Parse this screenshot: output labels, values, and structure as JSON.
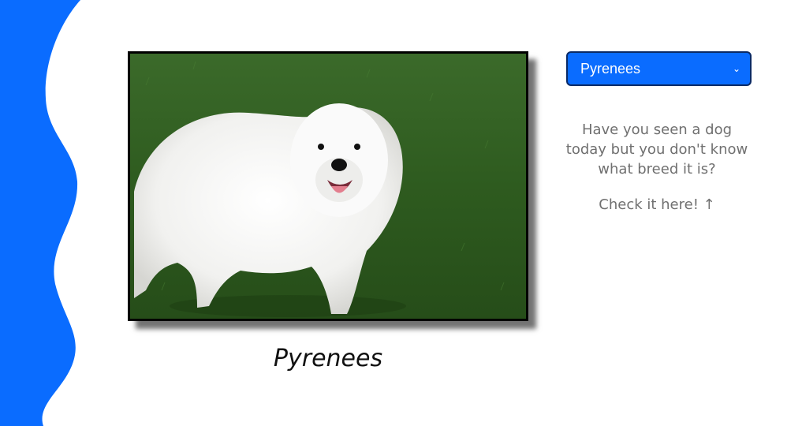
{
  "colors": {
    "accent": "#0a6cff",
    "info_text": "#707070"
  },
  "breed_select": {
    "selected": "Pyrenees",
    "icon": "chevron-down-icon"
  },
  "photo": {
    "icon": "dog-photo"
  },
  "caption": "Pyrenees",
  "info": {
    "question": "Have you seen a dog today but you don't know what breed it is?",
    "cta": "Check it here! ↑"
  }
}
